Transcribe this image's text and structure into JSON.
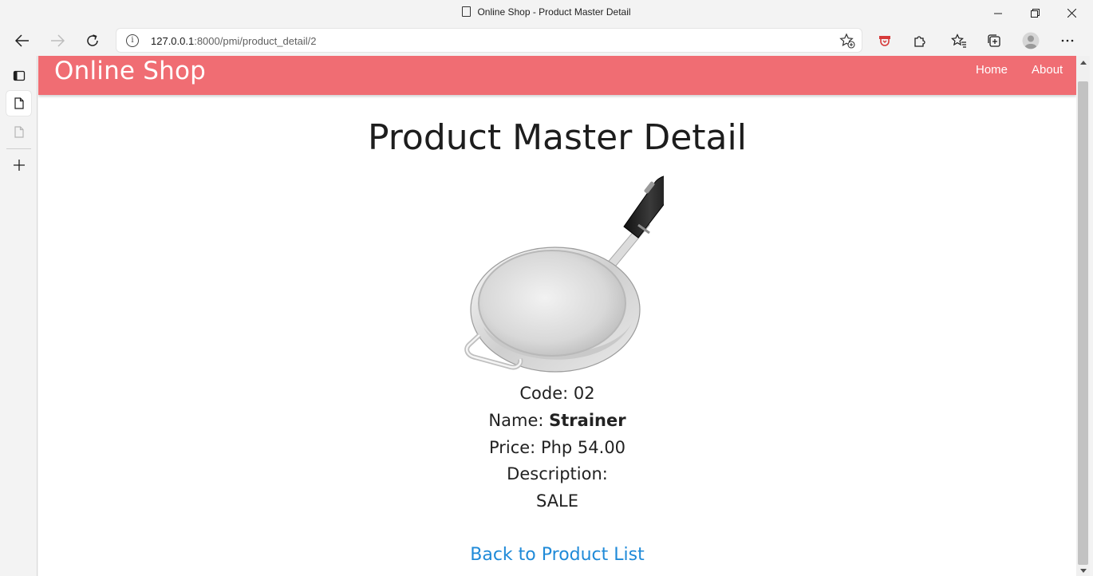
{
  "browser": {
    "tab_title": "Online Shop - Product Master Detail",
    "url_host": "127.0.0.1",
    "url_rest": ":8000/pmi/product_detail/2",
    "icons": [
      "back-icon",
      "forward-icon",
      "refresh-icon",
      "site-info-icon",
      "add-favorite-icon",
      "extension-shield-icon",
      "extensions-icon",
      "favorites-icon",
      "collections-icon",
      "profile-icon",
      "more-icon",
      "minimize-icon",
      "restore-icon",
      "close-icon"
    ]
  },
  "sidebar": {
    "icons": [
      "tab-actions-icon",
      "active-tab-page-icon",
      "tab-page-icon",
      "new-tab-icon"
    ]
  },
  "site": {
    "brand": "Online Shop",
    "nav": [
      {
        "label": "Home"
      },
      {
        "label": "About"
      }
    ],
    "accent_color": "#f06d73",
    "link_color": "#1f8ad8"
  },
  "product": {
    "heading": "Product Master Detail",
    "image_alt": "strainer",
    "code_label": "Code:",
    "code": "02",
    "name_label": "Name:",
    "name": "Strainer",
    "price_label": "Price:",
    "price": "Php 54.00",
    "description_label": "Description:",
    "description": "SALE",
    "back_link": "Back to Product List"
  }
}
